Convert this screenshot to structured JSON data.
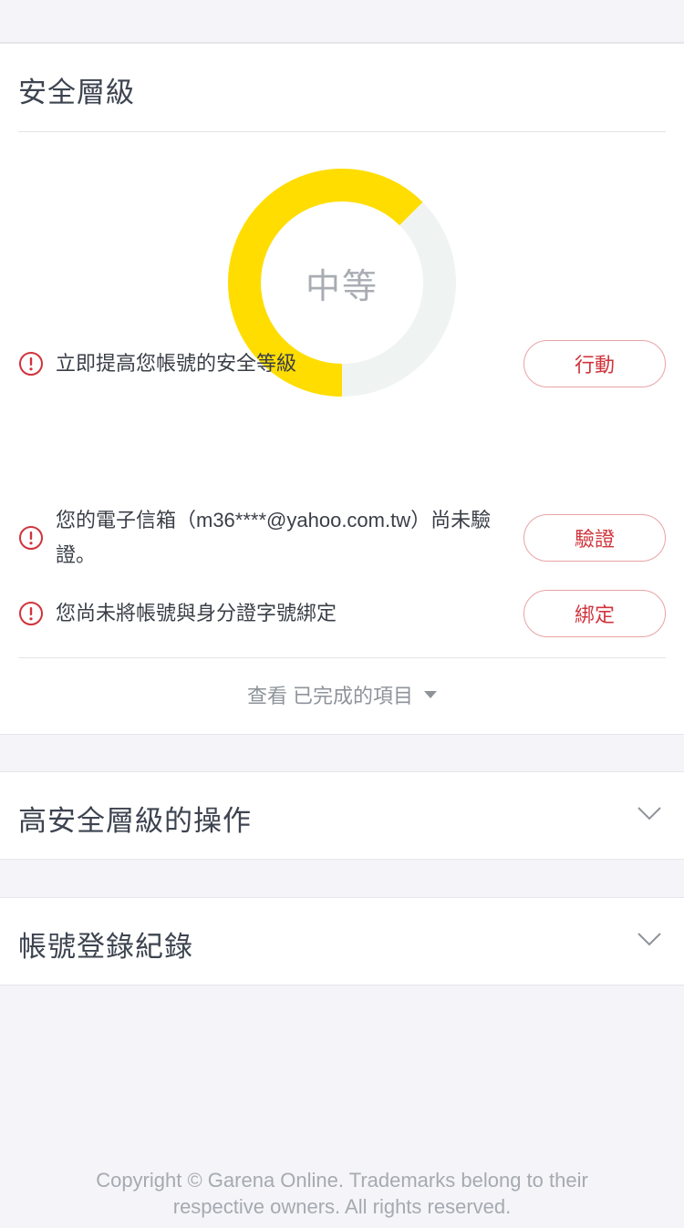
{
  "security": {
    "title": "安全層級",
    "level_label": "中等",
    "level_fraction": 0.625,
    "gauge_color": "#ffdd00",
    "gauge_track_color": "#eff4f3",
    "items": [
      {
        "text": "立即提高您帳號的安全等級",
        "button": "行動",
        "icon": "warning-circle-icon"
      },
      {
        "text": "您的電子信箱（m36****@yahoo.com.tw）尚未驗證。",
        "button": "驗證",
        "icon": "warning-circle-icon"
      },
      {
        "text": "您尚未將帳號與身分證字號綁定",
        "button": "綁定",
        "icon": "warning-circle-icon"
      }
    ],
    "view_completed": "查看 已完成的項目",
    "accent_color": "#d0343c"
  },
  "sections": [
    {
      "title": "高安全層級的操作",
      "icon": "chevron-down-icon"
    },
    {
      "title": "帳號登錄紀錄",
      "icon": "chevron-down-icon"
    }
  ],
  "footer": {
    "line1": "Copyright © Garena Online. Trademarks belong to their",
    "line2": "respective owners. All rights reserved."
  }
}
